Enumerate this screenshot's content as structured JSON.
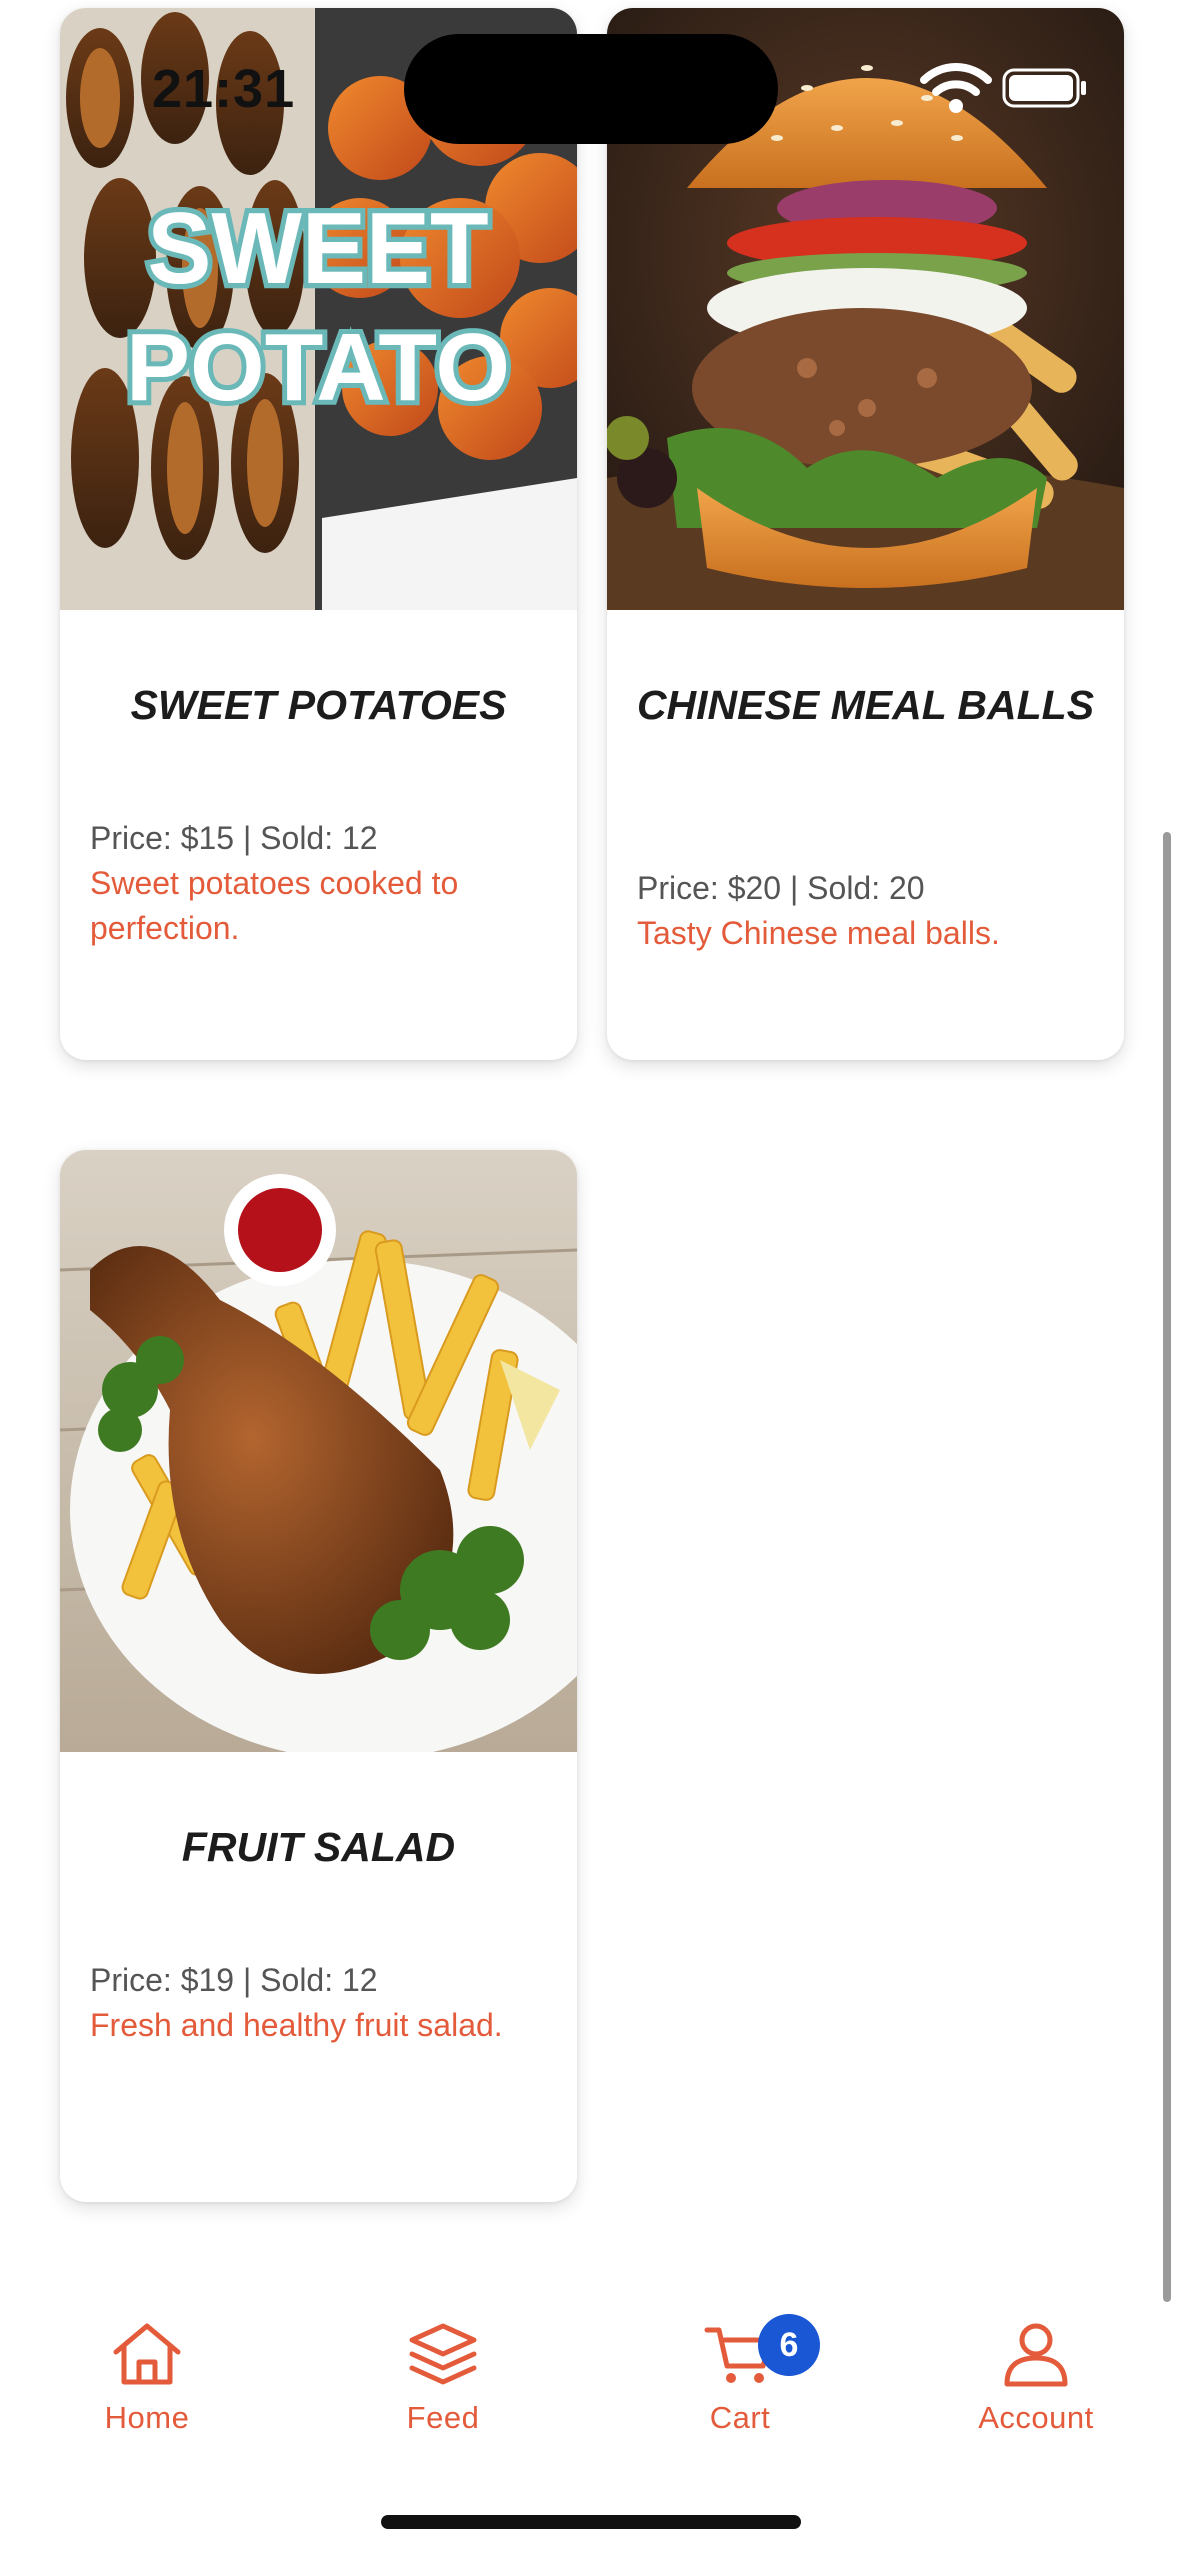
{
  "status_bar": {
    "time": "21:31"
  },
  "products": [
    {
      "title": "SWEET POTATOES",
      "meta": "Price: $15 | Sold: 12",
      "description": "Sweet potatoes cooked to perfection.",
      "image_text_line1": "SWEET",
      "image_text_line2": "POTATO"
    },
    {
      "title": "CHINESE MEAL BALLS",
      "meta": "Price: $20 | Sold: 20",
      "description": "Tasty Chinese meal balls."
    },
    {
      "title": "FRUIT SALAD",
      "meta": "Price: $19 | Sold: 12",
      "description": "Fresh and healthy fruit salad."
    }
  ],
  "nav": {
    "items": [
      {
        "label": "Home",
        "icon": "home-icon"
      },
      {
        "label": "Feed",
        "icon": "layers-icon"
      },
      {
        "label": "Cart",
        "icon": "cart-icon",
        "badge": "6"
      },
      {
        "label": "Account",
        "icon": "user-icon"
      }
    ]
  },
  "colors": {
    "accent": "#e35b3a",
    "badge": "#1957d4"
  }
}
